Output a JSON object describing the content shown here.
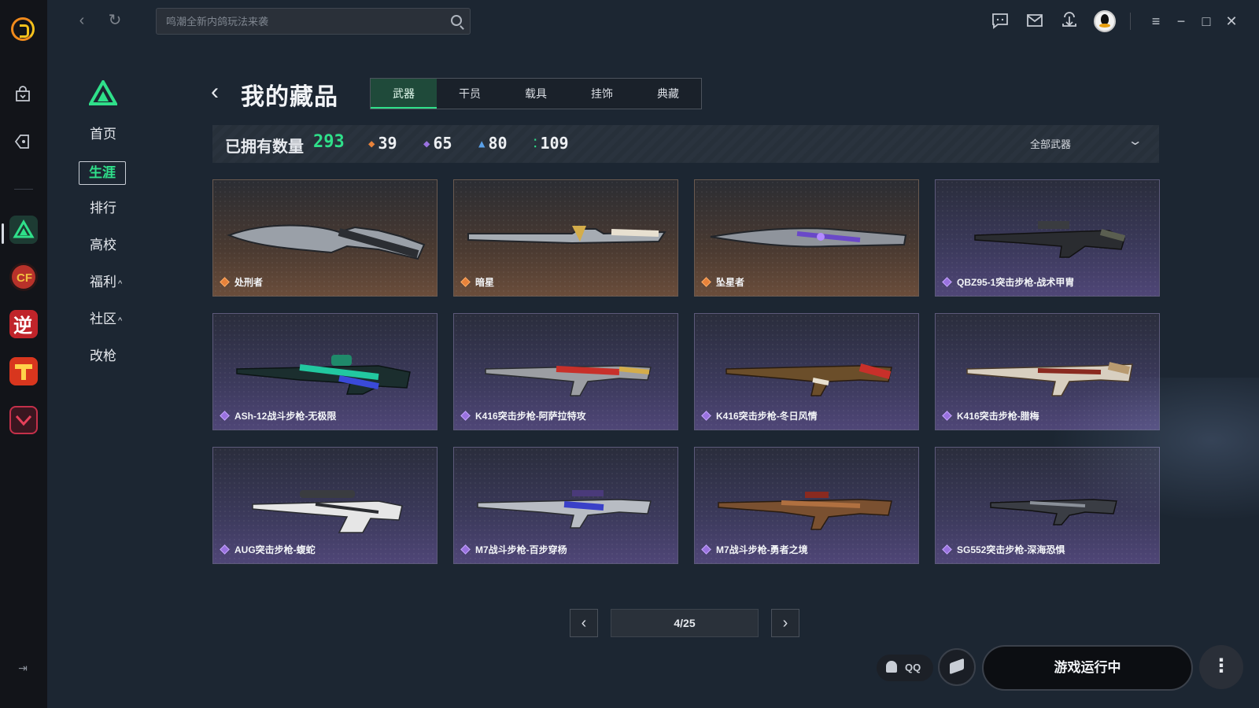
{
  "topbar": {
    "search_placeholder": "鸣潮全新内鸽玩法来袭"
  },
  "side_nav": {
    "items": [
      {
        "label": "首页"
      },
      {
        "label": "生涯",
        "active": true
      },
      {
        "label": "排行"
      },
      {
        "label": "高校"
      },
      {
        "label": "福利",
        "caret": "^"
      },
      {
        "label": "社区",
        "caret": "^"
      },
      {
        "label": "改枪"
      }
    ]
  },
  "header": {
    "title": "我的藏品",
    "tabs": [
      "武器",
      "干员",
      "载具",
      "挂饰",
      "典藏"
    ],
    "active_tab": "武器"
  },
  "stats": {
    "owned_label": "已拥有数量",
    "owned_total": "293",
    "rarities": [
      {
        "value": "39",
        "color": "#e8823a"
      },
      {
        "value": "65",
        "color": "#9a72e0"
      },
      {
        "value": "80",
        "color": "#5aa0e8"
      },
      {
        "value": "109",
        "color": "#2fe08a"
      }
    ],
    "filter_label": "全部武器"
  },
  "items": [
    {
      "name": "处刑者",
      "rarity": "gold",
      "icon": "knife-icon"
    },
    {
      "name": "暗星",
      "rarity": "gold",
      "icon": "knife-icon"
    },
    {
      "name": "坠星者",
      "rarity": "gold",
      "icon": "knife-icon"
    },
    {
      "name": "QBZ95-1突击步枪-战术甲胄",
      "rarity": "purple",
      "icon": "rifle-icon"
    },
    {
      "name": "ASh-12战斗步枪-无极限",
      "rarity": "purple",
      "icon": "rifle-icon"
    },
    {
      "name": "K416突击步枪-阿萨拉特攻",
      "rarity": "purple",
      "icon": "rifle-icon"
    },
    {
      "name": "K416突击步枪-冬日风情",
      "rarity": "purple",
      "icon": "rifle-icon"
    },
    {
      "name": "K416突击步枪-腊梅",
      "rarity": "purple",
      "icon": "rifle-icon"
    },
    {
      "name": "AUG突击步枪-蝮蛇",
      "rarity": "purple",
      "icon": "rifle-icon"
    },
    {
      "name": "M7战斗步枪-百步穿杨",
      "rarity": "purple",
      "icon": "rifle-icon"
    },
    {
      "name": "M7战斗步枪-勇者之境",
      "rarity": "purple",
      "icon": "rifle-icon"
    },
    {
      "name": "SG552突击步枪-深海恐惧",
      "rarity": "purple",
      "icon": "rifle-icon"
    }
  ],
  "pagination": {
    "current": "4/25"
  },
  "footer": {
    "qq_label": "QQ",
    "launch_label": "游戏运行中",
    "more_label": "⋮"
  }
}
